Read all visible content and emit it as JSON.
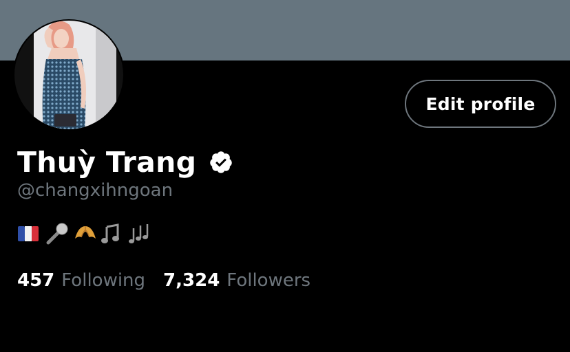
{
  "colors": {
    "banner": "#66757f",
    "background": "#000000",
    "secondary_text": "#6e767d",
    "primary_text": "#ffffff"
  },
  "profile": {
    "display_name": "Thuỳ Trang",
    "handle": "@changxihngoan",
    "verified_icon": "verified-badge-icon",
    "edit_button_label": "Edit profile"
  },
  "bio": {
    "emojis": [
      "flag-france-icon",
      "microphone-icon",
      "croissant-icon",
      "musical-note-icon",
      "musical-notes-icon"
    ]
  },
  "stats": {
    "following_count": "457",
    "following_label": "Following",
    "followers_count": "7,324",
    "followers_label": "Followers"
  }
}
